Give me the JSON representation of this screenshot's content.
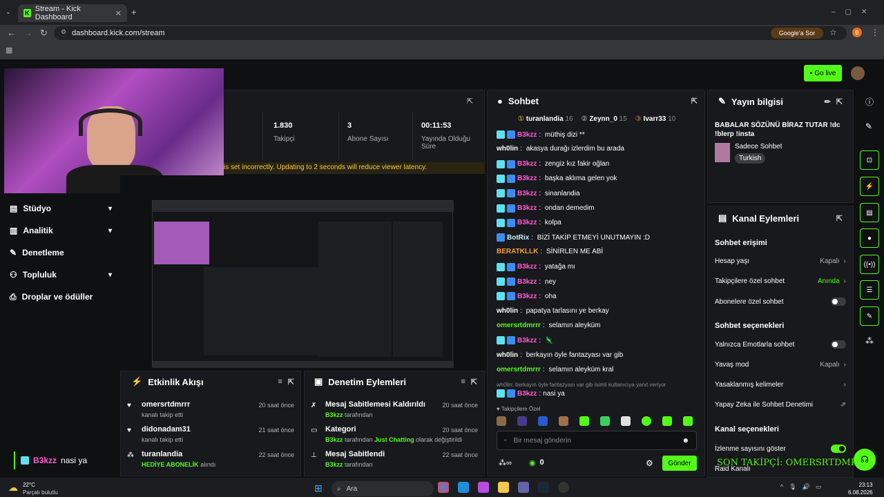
{
  "browser": {
    "tab_title": "Stream - Kick Dashboard",
    "url": "dashboard.kick.com/stream",
    "ask_google": "Google'a Sor",
    "profile_initial": "B"
  },
  "topbar": {
    "go_live": "Go live"
  },
  "sidebar": {
    "items": [
      {
        "label": "Stüdyo",
        "chevron": true
      },
      {
        "label": "Analitik",
        "chevron": true
      },
      {
        "label": "Denetleme",
        "chevron": false
      },
      {
        "label": "Topluluk",
        "chevron": true
      },
      {
        "label": "Droplar ve ödüller",
        "chevron": false
      }
    ],
    "last_chat": {
      "user": "B3kzz",
      "text": "nasi ya"
    }
  },
  "stats": [
    {
      "value": "1.830",
      "label": "Takipçi"
    },
    {
      "value": "3",
      "label": "Abone Sayısı"
    },
    {
      "value": "00:11:53",
      "label": "Yayında Olduğu Süre"
    }
  ],
  "warning": "is set incorrectly. Updating to 2 seconds will reduce viewer latency.",
  "chat": {
    "title": "Sohbet",
    "top": [
      {
        "name": "turanlandia",
        "count": "16"
      },
      {
        "name": "Zeynn_0",
        "count": "15"
      },
      {
        "name": "Ivarr33",
        "count": "10"
      }
    ],
    "messages": [
      {
        "user": "B3kzz",
        "text": "müthiş dizi **",
        "style": "u1",
        "badges": 2
      },
      {
        "user": "wh0lin",
        "text": "akasya durağı izlerdim bu arada",
        "style": "u2",
        "badges": 0
      },
      {
        "user": "B3kzz",
        "text": "zengiz kız fakir oğlan",
        "style": "u1",
        "badges": 2
      },
      {
        "user": "B3kzz",
        "text": "başka aklıma gelen yok",
        "style": "u1",
        "badges": 2
      },
      {
        "user": "B3kzz",
        "text": "sinanlandia",
        "style": "u1",
        "badges": 2
      },
      {
        "user": "B3kzz",
        "text": "ondan demedim",
        "style": "u1",
        "badges": 2
      },
      {
        "user": "B3kzz",
        "text": "kolpa",
        "style": "u1",
        "badges": 2
      },
      {
        "user": "BotRix",
        "text": "BİZİ TAKİP ETMEYİ UNUTMAYIN :D",
        "style": "botx",
        "badges": 1
      },
      {
        "user": "BERATKLLK",
        "text": "SİNİRLEN ME ABİ",
        "style": "u4",
        "badges": 0
      },
      {
        "user": "B3kzz",
        "text": "yatağa mı",
        "style": "u1",
        "badges": 2
      },
      {
        "user": "B3kzz",
        "text": "ney",
        "style": "u1",
        "badges": 2
      },
      {
        "user": "B3kzz",
        "text": "oha",
        "style": "u1",
        "badges": 2
      },
      {
        "user": "wh0lin",
        "text": "papatya tarlasını ye berkay",
        "style": "u2",
        "badges": 0
      },
      {
        "user": "omersrtdmrrr",
        "text": "selamın aleyküm",
        "style": "u3",
        "badges": 0
      },
      {
        "user": "B3kzz",
        "text": "🦎",
        "style": "u1",
        "badges": 2
      },
      {
        "user": "wh0lin",
        "text": "berkayın öyle fantazyası var gib",
        "style": "u2",
        "badges": 0
      },
      {
        "user": "omersrtdmrrr",
        "text": "selamın aleyküm kral",
        "style": "u3",
        "badges": 0
      }
    ],
    "reply_hint": "wh0lin: berkayın öyle fantazyası var gib isimli kullanıcıya yanıt veriyor",
    "reply": {
      "user": "B3kzz",
      "text": "nasi ya"
    },
    "followers_only": "Takipçilere Özel",
    "input_placeholder": "Bir mesaj gönderin",
    "points": "0",
    "send": "Gönder"
  },
  "stream_info": {
    "header": "Yayın bilgisi",
    "title": "BABALAR SÖZÜNÜ BİRAZ TUTAR !dc !blerp !insta",
    "chat_mode": "Sadece Sohbet",
    "language": "Turkish"
  },
  "channel_actions": {
    "header": "Kanal Eylemleri",
    "sections": [
      {
        "title": "Sohbet erişimi",
        "rows": [
          {
            "label": "Hesap yaşı",
            "value": "Kapalı",
            "kind": "chevron"
          },
          {
            "label": "Takipçilere özel sohbet",
            "value": "Anında",
            "kind": "chevron-green"
          },
          {
            "label": "Abonelere özel sohbet",
            "value": "",
            "kind": "toggle-off"
          }
        ]
      },
      {
        "title": "Sohbet seçenekleri",
        "rows": [
          {
            "label": "Yalnızca Emotlarla sohbet",
            "value": "",
            "kind": "toggle-off"
          },
          {
            "label": "Yavaş mod",
            "value": "Kapalı",
            "kind": "chevron"
          },
          {
            "label": "Yasaklanmış kelimeler",
            "value": "",
            "kind": "chevron"
          },
          {
            "label": "Yapay Zeka ile Sohbet Denetimi",
            "value": "",
            "kind": "external"
          }
        ]
      },
      {
        "title": "Kanal seçenekleri",
        "rows": [
          {
            "label": "İzlenme sayısını göster",
            "value": "",
            "kind": "toggle-on"
          },
          {
            "label": "Raid Kanalı",
            "value": "",
            "kind": "none"
          }
        ]
      }
    ],
    "overlay": "SON TAKİPÇİ: OMERSRTDMRRR"
  },
  "activity_feed": {
    "title": "Etkinlik Akışı",
    "items": [
      {
        "user": "omersrtdmrrr",
        "sub": "kanalı takip etti",
        "time": "20 saat önce",
        "icon": "heart"
      },
      {
        "user": "didonadam31",
        "sub": "kanalı takip etti",
        "time": "21 saat önce",
        "icon": "heart"
      },
      {
        "user": "turanlandia",
        "sub_green": "HEDİYE ABONELİK",
        "sub": "alındı",
        "time": "22 saat önce",
        "icon": "gift"
      }
    ]
  },
  "mod_actions": {
    "title": "Denetim Eylemleri",
    "items": [
      {
        "title": "Mesaj Sabitlemesi Kaldırıldı",
        "by": "B3kzz",
        "sub": "tarafından",
        "time": "20 saat önce"
      },
      {
        "title": "Kategori",
        "by": "B3kzz",
        "sub": "tarafından",
        "cat": "Just Chatting",
        "sub2": "olarak değiştirildi",
        "time": "20 saat önce"
      },
      {
        "title": "Mesaj Sabitlendi",
        "by": "B3kzz",
        "sub": "tarafından",
        "time": "22 saat önce"
      }
    ]
  },
  "taskbar": {
    "weather_temp": "22°C",
    "weather_text": "Parçalı bulutlu",
    "search": "Ara",
    "time": "23:13",
    "date": "6.08.2026"
  },
  "colors": {
    "accent": "#53fc18",
    "panel": "#18191c",
    "bg": "#0f1012",
    "pink": "#ff5bd6"
  }
}
